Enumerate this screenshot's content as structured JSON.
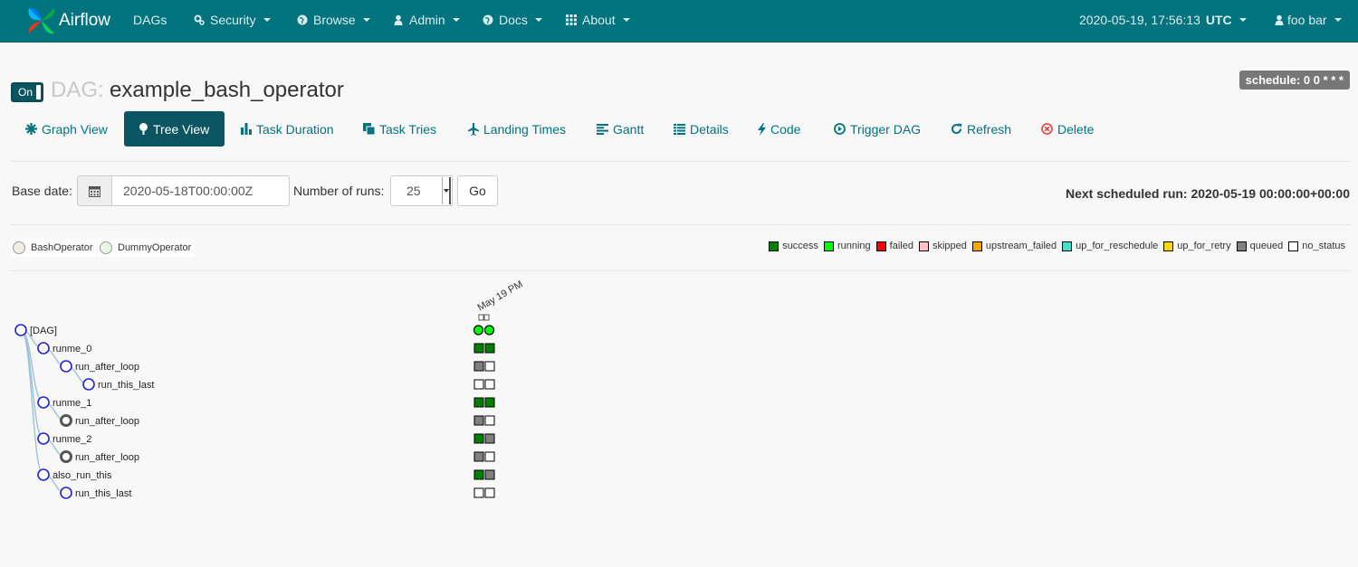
{
  "navbar": {
    "brand": "Airflow",
    "items": [
      {
        "label": "DAGs",
        "icon": "none"
      },
      {
        "label": "Security",
        "icon": "cogs-icon"
      },
      {
        "label": "Browse",
        "icon": "globe-icon"
      },
      {
        "label": "Admin",
        "icon": "user-icon"
      },
      {
        "label": "Docs",
        "icon": "globe-icon"
      },
      {
        "label": "About",
        "icon": "grid-icon"
      }
    ],
    "clock": "2020-05-19, 17:56:13",
    "timezone": "UTC",
    "user": "foo bar"
  },
  "header": {
    "toggle_label": "On",
    "dag_prefix": "DAG:",
    "dag_id": "example_bash_operator",
    "schedule": "schedule: 0 0 * * *"
  },
  "tabs": [
    {
      "label": "Graph View",
      "icon": "asterisk-icon",
      "active": false
    },
    {
      "label": "Tree View",
      "icon": "tree-icon",
      "active": true
    },
    {
      "label": "Task Duration",
      "icon": "bar-chart-icon",
      "active": false
    },
    {
      "label": "Task Tries",
      "icon": "duplicate-icon",
      "active": false
    },
    {
      "label": "Landing Times",
      "icon": "plane-icon",
      "active": false
    },
    {
      "label": "Gantt",
      "icon": "align-left-icon",
      "active": false
    },
    {
      "label": "Details",
      "icon": "list-icon",
      "active": false
    },
    {
      "label": "Code",
      "icon": "flash-icon",
      "active": false
    },
    {
      "label": "Trigger DAG",
      "icon": "play-circle-icon",
      "active": false
    },
    {
      "label": "Refresh",
      "icon": "refresh-icon",
      "active": false
    },
    {
      "label": "Delete",
      "icon": "remove-circle-icon",
      "active": false
    }
  ],
  "form": {
    "base_date_label": "Base date:",
    "base_date_value": "2020-05-18T00:00:00Z",
    "num_runs_label": "Number of runs:",
    "num_runs_value": "25",
    "go_label": "Go",
    "next_run": "Next scheduled run: 2020-05-19 00:00:00+00:00"
  },
  "operators": [
    {
      "name": "BashOperator",
      "color": "#f0ede4"
    },
    {
      "name": "DummyOperator",
      "color": "#e8f7e4"
    }
  ],
  "states": [
    {
      "name": "success",
      "color": "#008000"
    },
    {
      "name": "running",
      "color": "#00ff00"
    },
    {
      "name": "failed",
      "color": "#ff0000"
    },
    {
      "name": "skipped",
      "color": "#ffc0cb"
    },
    {
      "name": "upstream_failed",
      "color": "#ffa500"
    },
    {
      "name": "up_for_reschedule",
      "color": "#40e0d0"
    },
    {
      "name": "up_for_retry",
      "color": "#ffd700"
    },
    {
      "name": "queued",
      "color": "#808080"
    },
    {
      "name": "no_status",
      "color": "#ffffff"
    }
  ],
  "tree": {
    "run_header_text": "May 19 PM",
    "nodes": [
      {
        "label": "[DAG]",
        "depth": 0,
        "parent": null,
        "marker": "open",
        "runs": [
          "running",
          "running"
        ]
      },
      {
        "label": "runme_0",
        "depth": 1,
        "parent": 0,
        "marker": "open",
        "runs": [
          "success",
          "success"
        ]
      },
      {
        "label": "run_after_loop",
        "depth": 2,
        "parent": 1,
        "marker": "open",
        "runs": [
          "queued",
          "no_status"
        ]
      },
      {
        "label": "run_this_last",
        "depth": 3,
        "parent": 2,
        "marker": "open",
        "runs": [
          "no_status",
          "no_status"
        ]
      },
      {
        "label": "runme_1",
        "depth": 1,
        "parent": 0,
        "marker": "open",
        "runs": [
          "success",
          "success"
        ]
      },
      {
        "label": "run_after_loop",
        "depth": 2,
        "parent": 4,
        "marker": "collapsed",
        "runs": [
          "queued",
          "no_status"
        ]
      },
      {
        "label": "runme_2",
        "depth": 1,
        "parent": 0,
        "marker": "open",
        "runs": [
          "success",
          "queued"
        ]
      },
      {
        "label": "run_after_loop",
        "depth": 2,
        "parent": 6,
        "marker": "collapsed",
        "runs": [
          "queued",
          "no_status"
        ]
      },
      {
        "label": "also_run_this",
        "depth": 1,
        "parent": 0,
        "marker": "open",
        "runs": [
          "success",
          "queued"
        ]
      },
      {
        "label": "run_this_last",
        "depth": 2,
        "parent": 8,
        "marker": "open",
        "runs": [
          "no_status",
          "no_status"
        ]
      }
    ]
  }
}
